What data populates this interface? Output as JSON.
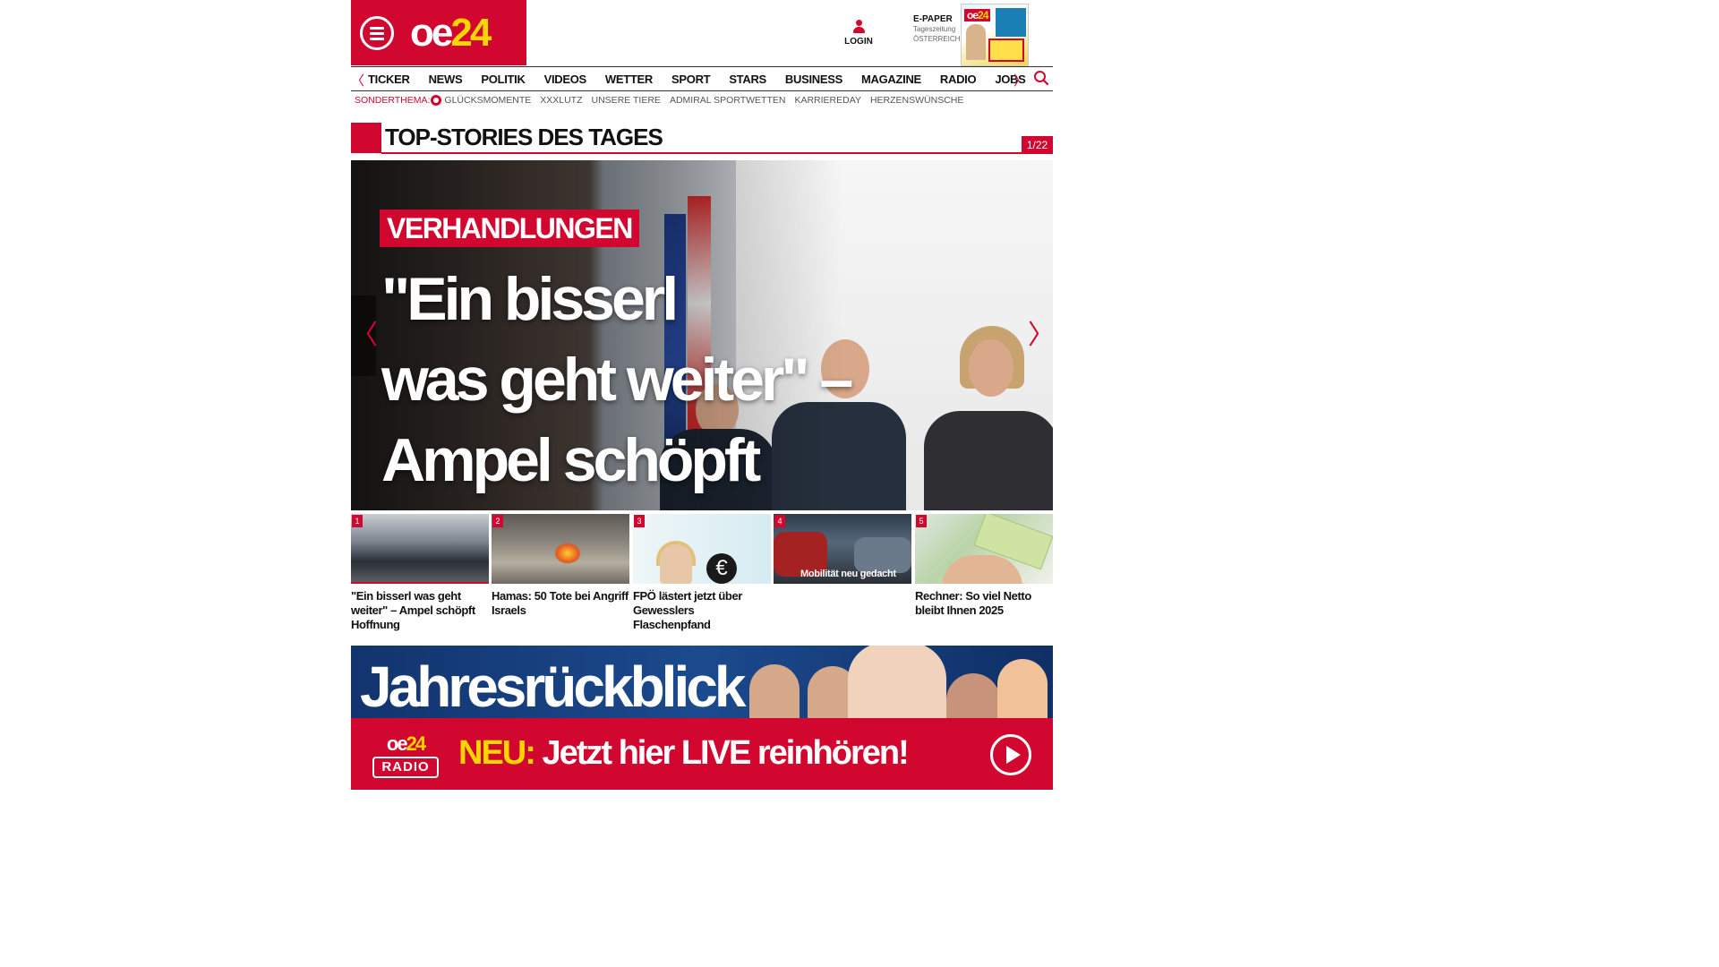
{
  "header": {
    "logo_main": "oe",
    "logo_accent": "24",
    "login_label": "LOGIN",
    "epaper": {
      "title": "E-PAPER",
      "subtitle": "Tageszeitung",
      "region": "ÖSTERREICH",
      "cover_logo_main": "oe",
      "cover_logo_accent": "24"
    }
  },
  "nav": {
    "items": [
      "TICKER",
      "NEWS",
      "POLITIK",
      "VIDEOS",
      "WETTER",
      "SPORT",
      "STARS",
      "BUSINESS",
      "MAGAZINE",
      "RADIO",
      "JOBS"
    ],
    "prev_glyph": "〈",
    "next_glyph": "〉"
  },
  "subnav": {
    "label": "SONDERTHEMA:",
    "items": [
      "GLÜCKSMOMENTE",
      "XXXLUTZ",
      "UNSERE TIERE",
      "ADMIRAL SPORTWETTEN",
      "KARRIEREDAY",
      "HERZENSWÜNSCHE"
    ]
  },
  "section": {
    "title": "TOP-STORIES DES TAGES",
    "counter": "1/22"
  },
  "hero": {
    "kicker": "VERHANDLUNGEN",
    "headline_line1": "\"Ein bisserl",
    "headline_line2": "was geht weiter\" –",
    "headline_line3": "Ampel schöpft Hoffnung",
    "prev_glyph": "〈",
    "next_glyph": "〉"
  },
  "thumbnails": [
    {
      "num": "1",
      "caption": "\"Ein bisserl was geht weiter\" – Ampel schöpft Hoffnung"
    },
    {
      "num": "2",
      "caption": "Hamas: 50 Tote bei Angriff Israels"
    },
    {
      "num": "3",
      "caption": "FPÖ lästert jetzt über Gewesslers Flaschenpfand"
    },
    {
      "num": "4",
      "caption": "",
      "overlay": "Mobilität neu gedacht"
    },
    {
      "num": "5",
      "caption": "Rechner: So viel Netto bleibt Ihnen 2025"
    }
  ],
  "banner": {
    "title": "Jahresrückblick",
    "radio_logo_main": "oe",
    "radio_logo_accent": "24",
    "radio_logo_word": "RADIO",
    "cta_prefix": "NEU:",
    "cta_text": " Jetzt hier LIVE reinhören!"
  },
  "colors": {
    "brand_red": "#d2072f",
    "brand_yellow": "#ffd500"
  }
}
